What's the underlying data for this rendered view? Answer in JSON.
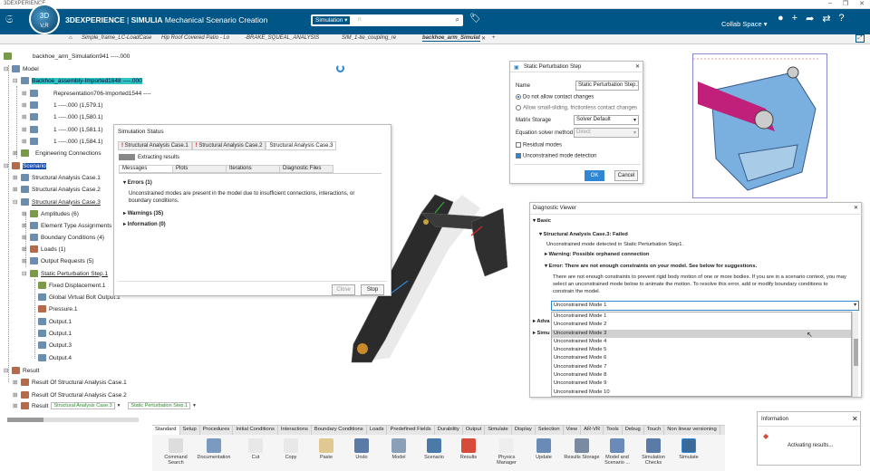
{
  "window": {
    "title": "3DEXPERIENCE",
    "controls": [
      "–",
      "❐",
      "✕"
    ]
  },
  "topbar": {
    "brand_bold": "3DEXPERIENCE",
    "brand_sep": " | ",
    "brand_app": "SIMULIA",
    "brand_module": " Mechanical Scenario Creation",
    "search_scope": "Simulation ▾",
    "search_placeholder": "n",
    "user": "Collab Space ▾",
    "compass_top": "3D",
    "compass_bottom": "V,R"
  },
  "tabs": [
    "Simple_frame_LC-LoadCase",
    "Hip Roof Covered Patio - Lo",
    "-BRAKE_SQUEAL_ANALYSIS",
    "SIM_1-tie_coupling_re",
    "backhoe_arm_Simulat"
  ],
  "tabs_close": "✕",
  "tabs_add": "+",
  "tree": {
    "root": "backhoe_arm_Simulation941 ----.000",
    "model": "Model",
    "assembly": "Backhoe_assembly-Imported1648 ----.000",
    "representation": "Representation706-Imported1544 ----",
    "parts": [
      "1 ----.000 (1,579.1)",
      "1 ----.000 (1,580.1)",
      "1 ----.000 (1,581.1)",
      "1 ----.000 (1,584.1)"
    ],
    "engineering": "Engineering Connections",
    "scenario": "Scenario",
    "cases": [
      "Structural Analysis Case.1",
      "Structural Analysis Case.2",
      "Structural Analysis Case.3"
    ],
    "case3_children": [
      "Amplitudes (6)",
      "Element Type Assignments",
      "Boundary Conditions (4)",
      "Loads (1)",
      "Output Requests (5)",
      "Static Perturbation Step.1"
    ],
    "step_children": [
      "Fixed Displacement.1",
      "Global Virtual Bolt Output.1",
      "Pressure.1",
      "Output.1",
      "Output.1",
      "Output.3",
      "Output.4"
    ],
    "result": "Result",
    "results": [
      "Result Of Structural Analysis Case.1",
      "Result Of Structural Analysis Case.2",
      "Result"
    ],
    "bottom_sel1": "Structural Analysis Case.3",
    "bottom_sel2": "Static Perturbation Step.1"
  },
  "sim_status": {
    "title": "Simulation Status",
    "tabs": [
      "Structural Analysis Case.1",
      "Structural Analysis Case.2",
      "Structural Analysis Case.3"
    ],
    "extracting": "Extracting results",
    "subtabs": [
      "Messages",
      "Plots",
      "Iterations",
      "Diagnostic Files"
    ],
    "errors_header": "Errors (1)",
    "error_text": "Unconstrained modes are present in the model due to insufficient connections, interactions, or boundary conditions.",
    "warnings": "Warnings (35)",
    "information": "Information (0)",
    "close": "Close",
    "stop": "Stop"
  },
  "sps": {
    "title": "Static Perturbation Step",
    "name_label": "Name",
    "name_value": "Static Perturbation Step.1",
    "opt1": "Do not allow contact changes",
    "opt2": "Allow small-sliding, frictionless contact changes",
    "matrix_label": "Matrix Storage",
    "matrix_value": "Solver Default",
    "eq_label": "Equation solver method",
    "eq_value": "Direct",
    "residual": "Residual modes",
    "unconstrained": "Unconstrained mode detection",
    "ok": "OK",
    "cancel": "Cancel"
  },
  "diag": {
    "title": "Diagnostic Viewer",
    "basic": "Basic",
    "case_failed": "Structural Analysis Case.3: Failed",
    "detected": "Unconstrained mode detected in Static Perturbation Step1.",
    "warning": "Warning: Possible orphaned connection",
    "error_head": "Error: There are not enough constraints on your model. See below for suggestions.",
    "error_body1": "There are not enough constraints to prevent rigid body motion of one or more bodies. If you are in a scenario context, you may",
    "error_body2": "select an unconstrained mode below to animate the motion.  To resolve this error, add or modify boundary conditions to",
    "error_body3": "constrain the model.",
    "selected_mode": "Unconstrained Mode 1",
    "adv": "Adva",
    "simu": "Simu",
    "modes": [
      "Unconstrained Mode 1",
      "Unconstrained Mode 2",
      "Unconstrained Mode 3",
      "Unconstrained Mode 4",
      "Unconstrained Mode 5",
      "Unconstrained Mode 6",
      "Unconstrained Mode 7",
      "Unconstrained Mode 8",
      "Unconstrained Mode 9",
      "Unconstrained Mode 10"
    ]
  },
  "toolbar": {
    "categories": [
      "Standard",
      "Setup",
      "Procedures",
      "Initial Conditions",
      "Interactions",
      "Boundary Conditions",
      "Loads",
      "Predefined Fields",
      "Durability",
      "Output",
      "Simulate",
      "Display",
      "Selection",
      "View",
      "AR-VR",
      "Tools",
      "Debug",
      "Touch",
      "Non linear versioning"
    ],
    "tools": [
      "Command Search",
      "Documentation",
      "Cut",
      "Copy",
      "Paste",
      "Undo",
      "Model",
      "Scenario",
      "Results",
      "Physics Manager",
      "Update",
      "Results Storage",
      "Model and Scenario ...",
      "Simulation Checks",
      "Simulate"
    ]
  },
  "info": {
    "title": "Information",
    "message": "Activating results..."
  },
  "colors": {
    "brand": "#005686",
    "highlight": "#2ec4c4",
    "accent": "#2f86d2"
  }
}
